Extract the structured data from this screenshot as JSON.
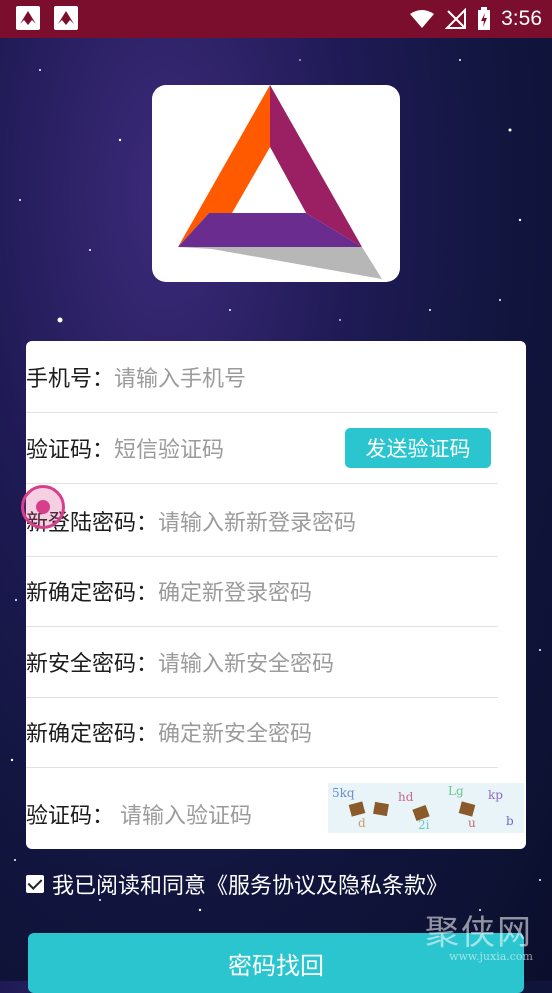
{
  "status_bar": {
    "time": "3:56",
    "icons": [
      "app-notification-icon",
      "app-notification-icon",
      "wifi-icon",
      "no-signal-icon",
      "battery-charging-icon"
    ]
  },
  "form": {
    "phone": {
      "label": "手机号：",
      "placeholder": "请输入手机号"
    },
    "sms_code": {
      "label": "验证码：",
      "placeholder": "短信验证码",
      "send_button": "发送验证码"
    },
    "new_login_password": {
      "label": "新登陆密码：",
      "placeholder": "请输入新新登录密码"
    },
    "confirm_login_password": {
      "label": "新确定密码：",
      "placeholder": "确定新登录密码"
    },
    "new_security_password": {
      "label": "新安全密码：",
      "placeholder": "请输入新安全密码"
    },
    "confirm_security_password": {
      "label": "新确定密码：",
      "placeholder": "确定新安全密码"
    },
    "captcha": {
      "label": "验证码：",
      "placeholder": "请输入验证码"
    }
  },
  "agreement": {
    "checked": true,
    "text": "我已阅读和同意《服务协议及隐私条款》"
  },
  "submit_button": "密码找回",
  "watermark": {
    "title": "聚侠网",
    "url": "www.juxia.com"
  },
  "colors": {
    "accent": "#2bc5cf",
    "status_bar": "#7a0e2c",
    "touch_indicator": "#d63f8c"
  }
}
